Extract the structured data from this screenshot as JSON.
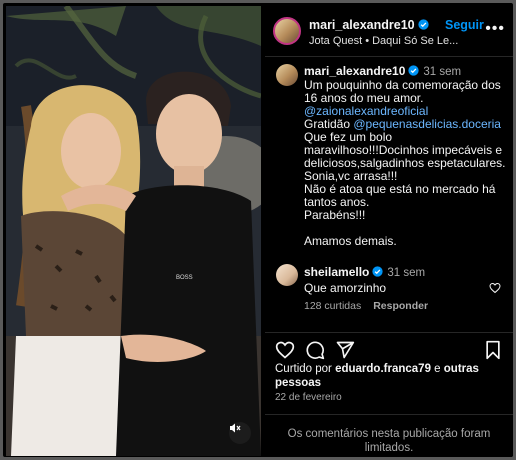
{
  "post": {
    "author": "mari_alexandre10",
    "follow_label": "Seguir",
    "more_label": "•••",
    "music": {
      "artist": "Jota Quest",
      "separator": "•",
      "song": "Daqui Só Se Le..."
    }
  },
  "caption": {
    "author": "mari_alexandre10",
    "time": "31 sem",
    "lines": [
      "Um pouquinho da comemoração dos",
      "16 anos do meu amor.",
      "@zaionalexandreoficial",
      "Gratidão",
      "@pequenasdelicias.doceria",
      "Que fez um bolo",
      "maravilhoso!!!Docinhos impecáveis e",
      "deliciosos,salgadinhos espetaculares.",
      "Sonia,vc arrasa!!!",
      "Não é atoa que está no mercado há",
      "tantos anos.",
      "Parabéns!!!",
      "Amamos demais."
    ]
  },
  "comment": {
    "author": "sheilamello",
    "time": "31 sem",
    "text": "Que amorzinho",
    "likes": "128 curtidas",
    "reply_label": "Responder"
  },
  "liked_by": {
    "prefix": "Curtido por",
    "user": "eduardo.franca79",
    "middle": "e",
    "others": "outras pessoas"
  },
  "date": "22 de fevereiro",
  "comments_limited": "Os comentários nesta publicação foram limitados.",
  "colors": {
    "accent": "#0095f6",
    "verified": "#0095f6",
    "link": "#6cb7ff"
  },
  "icons": {
    "more": "more-icon",
    "verified": "verified-badge-icon",
    "heart": "heart-icon",
    "comment": "comment-icon",
    "share": "share-icon",
    "save": "bookmark-icon",
    "mute": "muted-speaker-icon"
  }
}
